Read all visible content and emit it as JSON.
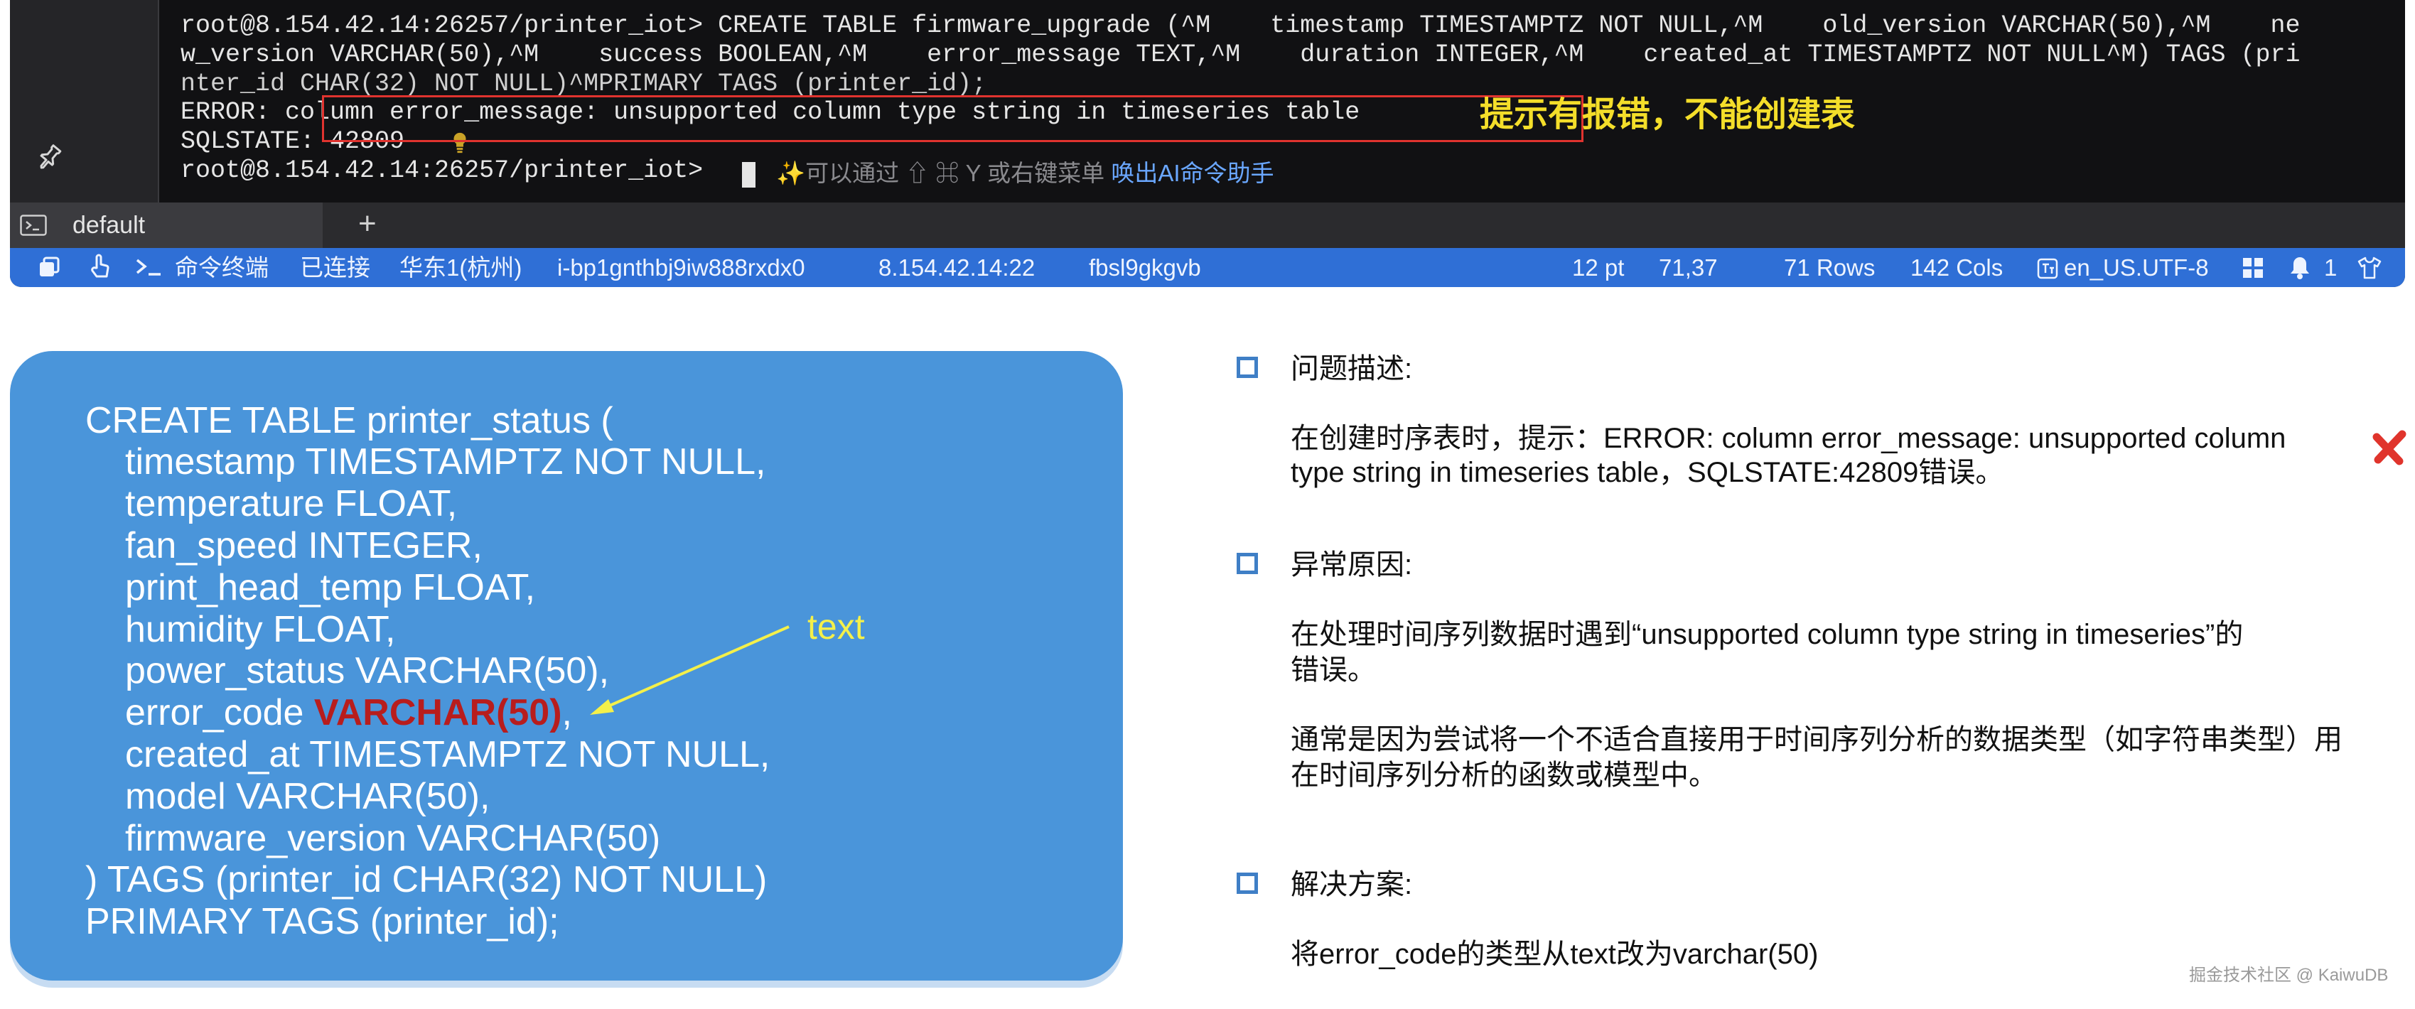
{
  "terminal": {
    "lines": [
      "",
      "root@8.154.42.14:26257/printer_iot> CREATE TABLE firmware_upgrade (^M    timestamp TIMESTAMPTZ NOT NULL,^M    old_version VARCHAR(50),^M    ne",
      "w_version VARCHAR(50),^M    success BOOLEAN,^M    error_message TEXT,^M    duration INTEGER,^M    created_at TIMESTAMPTZ NOT NULL^M) TAGS (pri",
      "nter_id CHAR(32) NOT NULL)^MPRIMARY TAGS (printer_id);",
      "ERROR: column error_message: unsupported column type string in timeseries table",
      "SQLSTATE: 42809",
      "root@8.154.42.14:26257/printer_iot> "
    ],
    "ai_hint": {
      "spark": "✨",
      "text": "可以通过 ⇧ ⌘ Y 或右键菜单 ",
      "link": "唤出AI命令助手"
    },
    "annotation": "提示有报错，不能创建表",
    "tab": {
      "label": "default",
      "add": "+"
    },
    "status": {
      "terminal_label": "命令终端",
      "connected": "已连接",
      "region": "华东1(杭州)",
      "instance_id": "i-bp1gnthbj9iw888rxdx0",
      "address": "8.154.42.14:22",
      "session": "fbsl9gkgvb",
      "font_size": "12 pt",
      "cursor_pos": "71,37",
      "rows": "71 Rows",
      "cols": "142 Cols",
      "encoding": "en_US.UTF-8",
      "notifications": "1"
    }
  },
  "code_panel": {
    "lines": [
      "CREATE TABLE printer_status (",
      "timestamp TIMESTAMPTZ NOT NULL,",
      "temperature FLOAT,",
      "fan_speed INTEGER,",
      "print_head_temp FLOAT,",
      "humidity FLOAT,",
      "power_status VARCHAR(50),",
      "error_code ",
      "created_at TIMESTAMPTZ NOT NULL,",
      "model VARCHAR(50),",
      "firmware_version VARCHAR(50)",
      ") TAGS (printer_id CHAR(32) NOT NULL)",
      "PRIMARY TAGS (printer_id);"
    ],
    "error_code_type": "VARCHAR(50)",
    "error_code_suffix": ",",
    "arrow_label": "text"
  },
  "description": {
    "problem_title": "问题描述:",
    "problem_line1": "在创建时序表时，提示：ERROR: column error_message: unsupported column",
    "problem_line2": "type string in timeseries table，SQLSTATE:42809错误。",
    "cause_title": "异常原因:",
    "cause_line1": "在处理时间序列数据时遇到“unsupported column type string in timeseries”的",
    "cause_line2": "错误。",
    "cause_line3": "通常是因为尝试将一个不适合直接用于时间序列分析的数据类型（如字符串类型）用",
    "cause_line4": "在时间序列分析的函数或模型中。",
    "solution_title": "解决方案:",
    "solution_line1": "将error_code的类型从text改为varchar(50)"
  },
  "watermark": "掘金技术社区 @ KaiwuDB",
  "colors": {
    "accent_blue": "#2f6fd6",
    "panel_blue": "#4a95da",
    "error_red": "#e0332f",
    "annotation_yellow": "#f4de2a"
  }
}
